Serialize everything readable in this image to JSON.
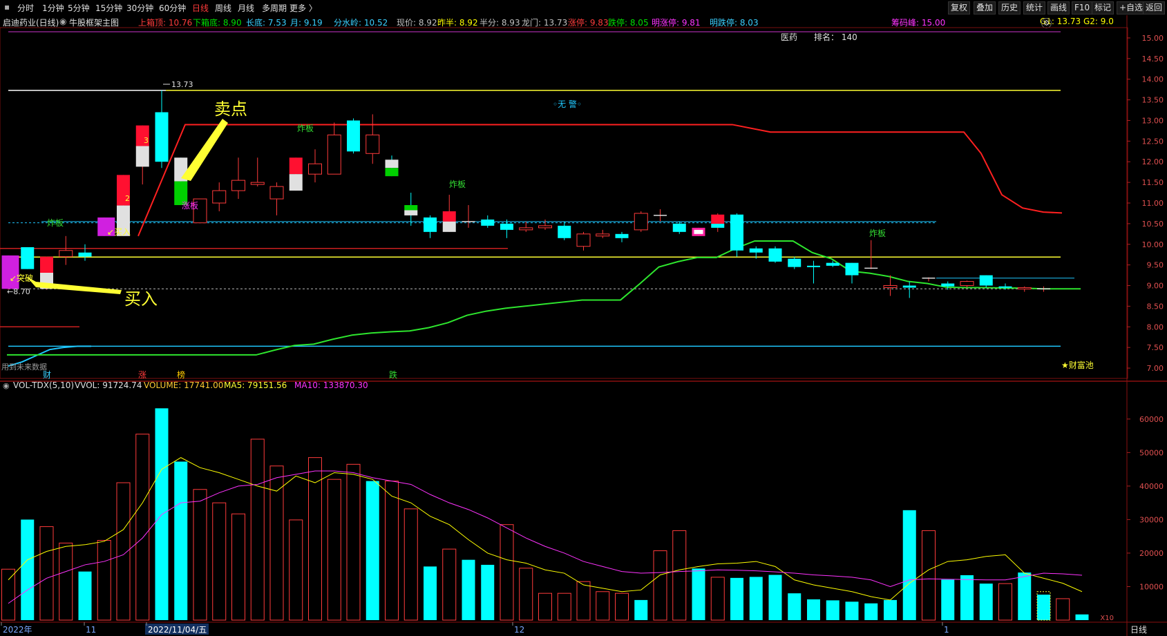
{
  "toolbar": {
    "periods": [
      "分时",
      "1分钟",
      "5分钟",
      "15分钟",
      "30分钟",
      "60分钟",
      "日线",
      "周线",
      "月线",
      "多周期",
      "更多 〉"
    ],
    "active_period": "日线",
    "right_buttons": [
      "复权",
      "叠加",
      "历史",
      "统计",
      "画线",
      "F10",
      "标记",
      "+自选",
      "返回"
    ]
  },
  "info": {
    "stock_name": "启迪药业(日线)",
    "indicator_name": "牛股框架主图",
    "items": [
      {
        "label": "上箱顶: 10.76",
        "color": "#ff3b3b"
      },
      {
        "label": "下箱底: 8.90",
        "color": "#00e000"
      },
      {
        "label": "长底: 7.53",
        "color": "#3ad0ff"
      },
      {
        "label": "月: 9.19",
        "color": "#3ad0ff"
      },
      {
        "label": "分水岭: 10.52",
        "color": "#3ad0ff"
      },
      {
        "label": "现价: 8.92",
        "color": "#c0c0c0"
      },
      {
        "label": "昨半: 8.92",
        "color": "#ffff00"
      },
      {
        "label": "半分: 8.93",
        "color": "#c0c0c0"
      },
      {
        "label": "龙门: 13.73",
        "color": "#c0c0c0"
      },
      {
        "label": "涨停: 9.83",
        "color": "#ff3b3b"
      },
      {
        "label": "跌停: 8.05",
        "color": "#00e000"
      },
      {
        "label": "明涨停: 9.81",
        "color": "#ff33ff"
      },
      {
        "label": "明跌停: 8.03",
        "color": "#3ad0ff"
      },
      {
        "label": "筹码峰: 15.00",
        "color": "#ff33ff"
      },
      {
        "label": "G1: 13.73  G2: 9.0",
        "color": "#ffff00"
      }
    ],
    "sector": "医药",
    "rank": "排名： 140"
  },
  "annotations": {
    "sell_point": "卖点",
    "buy_point": "买入",
    "tupo": "突破",
    "mairu": "买入",
    "zhaban": "炸板",
    "zhangban": "涨板",
    "high_mark": "13.73",
    "low_mark": "8.70",
    "no_alert": "◦无 警◦",
    "future_data": "用到未来数据",
    "cai": "财",
    "zhang": "涨",
    "bang": "榜",
    "die": "跌",
    "fortune_pool": "★财富池",
    "num2": "2",
    "num3": "3"
  },
  "volume_header": {
    "name": "VOL-TDX(5,10)",
    "vvol": "VVOL: 91724.74",
    "volume": "VOLUME: 17741.00",
    "ma5": "MA5: 79151.56",
    "ma10": "MA10: 133870.30"
  },
  "x_axis": {
    "labels": [
      "2022年",
      "11",
      "2022/11/04/五",
      "12",
      "1"
    ],
    "unit": "X10",
    "period": "日线"
  },
  "colors": {
    "up": "#ff3b3b",
    "down": "#00ffff",
    "ma5": "#ffff00",
    "ma10": "#ff33ff",
    "green_line": "#2ee62e",
    "cyan_line": "#1fc8ff"
  },
  "chart_data": {
    "type": "candlestick",
    "price_axis": {
      "ylim": [
        6.75,
        15.25
      ],
      "ticks": [
        7.0,
        7.5,
        8.0,
        8.5,
        9.0,
        9.5,
        10.0,
        10.5,
        11.0,
        11.5,
        12.0,
        12.5,
        13.0,
        13.5,
        14.0,
        14.5,
        15.0
      ]
    },
    "volume_axis": {
      "ylim": [
        0,
        68000
      ],
      "ticks": [
        10000,
        20000,
        30000,
        40000,
        50000,
        60000
      ]
    },
    "candles": [
      {
        "o": 9.73,
        "c": 8.92,
        "h": 9.73,
        "l": 8.9,
        "style": "magenta"
      },
      {
        "o": 9.4,
        "c": 9.93,
        "h": 9.93,
        "l": 9.4,
        "style": "down"
      },
      {
        "o": 9.7,
        "c": 8.92,
        "h": 9.7,
        "l": 8.9,
        "style": "redwhite"
      },
      {
        "o": 9.7,
        "c": 9.85,
        "h": 10.2,
        "l": 9.5,
        "style": "up"
      },
      {
        "o": 9.8,
        "c": 9.7,
        "h": 10.0,
        "l": 9.6,
        "style": "down"
      },
      {
        "o": 10.2,
        "c": 10.65,
        "h": 10.65,
        "l": 10.2,
        "style": "magenta"
      },
      {
        "o": 10.2,
        "c": 11.68,
        "h": 11.68,
        "l": 10.2,
        "style": "redwhite"
      },
      {
        "o": 11.88,
        "c": 12.88,
        "h": 12.88,
        "l": 11.45,
        "style": "redwhite"
      },
      {
        "o": 12.0,
        "c": 13.2,
        "h": 13.73,
        "l": 11.85,
        "style": "down"
      },
      {
        "o": 12.1,
        "c": 10.95,
        "h": 12.1,
        "l": 10.95,
        "style": "whitegreen"
      },
      {
        "o": 11.1,
        "c": 10.52,
        "h": 11.1,
        "l": 10.52,
        "style": "up"
      },
      {
        "o": 11.0,
        "c": 11.3,
        "h": 11.5,
        "l": 10.8,
        "style": "up"
      },
      {
        "o": 11.3,
        "c": 11.55,
        "h": 12.1,
        "l": 11.1,
        "style": "up"
      },
      {
        "o": 11.5,
        "c": 11.45,
        "h": 12.1,
        "l": 11.4,
        "style": "up"
      },
      {
        "o": 11.4,
        "c": 11.1,
        "h": 11.5,
        "l": 10.7,
        "style": "up"
      },
      {
        "o": 11.3,
        "c": 12.1,
        "h": 12.1,
        "l": 11.3,
        "style": "redwhite"
      },
      {
        "o": 11.7,
        "c": 11.95,
        "h": 12.3,
        "l": 11.5,
        "style": "up"
      },
      {
        "o": 11.7,
        "c": 12.65,
        "h": 12.95,
        "l": 11.7,
        "style": "up"
      },
      {
        "o": 12.25,
        "c": 13.0,
        "h": 13.05,
        "l": 12.2,
        "style": "down"
      },
      {
        "o": 12.65,
        "c": 12.2,
        "h": 13.15,
        "l": 11.95,
        "style": "up"
      },
      {
        "o": 11.65,
        "c": 12.05,
        "h": 12.15,
        "l": 11.65,
        "style": "whitegreen"
      },
      {
        "o": 10.7,
        "c": 10.95,
        "h": 11.25,
        "l": 10.45,
        "style": "greenwhite"
      },
      {
        "o": 10.65,
        "c": 10.3,
        "h": 10.7,
        "l": 10.15,
        "style": "down"
      },
      {
        "o": 10.3,
        "c": 10.8,
        "h": 11.2,
        "l": 10.3,
        "style": "redwhite"
      },
      {
        "o": 10.55,
        "c": 10.55,
        "h": 10.95,
        "l": 10.4,
        "style": "doji"
      },
      {
        "o": 10.6,
        "c": 10.45,
        "h": 10.7,
        "l": 10.4,
        "style": "down"
      },
      {
        "o": 10.5,
        "c": 10.35,
        "h": 10.6,
        "l": 10.15,
        "style": "down"
      },
      {
        "o": 10.35,
        "c": 10.4,
        "h": 10.55,
        "l": 10.3,
        "style": "up"
      },
      {
        "o": 10.4,
        "c": 10.45,
        "h": 10.6,
        "l": 10.35,
        "style": "up"
      },
      {
        "o": 10.45,
        "c": 10.15,
        "h": 10.55,
        "l": 10.1,
        "style": "down"
      },
      {
        "o": 9.95,
        "c": 10.25,
        "h": 10.3,
        "l": 9.85,
        "style": "up"
      },
      {
        "o": 10.25,
        "c": 10.2,
        "h": 10.35,
        "l": 10.15,
        "style": "up"
      },
      {
        "o": 10.25,
        "c": 10.15,
        "h": 10.3,
        "l": 10.05,
        "style": "down"
      },
      {
        "o": 10.35,
        "c": 10.75,
        "h": 10.8,
        "l": 10.3,
        "style": "up"
      },
      {
        "o": 10.7,
        "c": 10.7,
        "h": 10.85,
        "l": 10.55,
        "style": "doji"
      },
      {
        "o": 10.5,
        "c": 10.3,
        "h": 10.55,
        "l": 10.25,
        "style": "down"
      },
      {
        "o": 10.25,
        "c": 10.35,
        "h": 10.4,
        "l": 10.2,
        "style": "magentabox"
      },
      {
        "o": 10.4,
        "c": 10.72,
        "h": 10.75,
        "l": 10.3,
        "style": "redcyan"
      },
      {
        "o": 10.72,
        "c": 9.85,
        "h": 10.75,
        "l": 9.7,
        "style": "down"
      },
      {
        "o": 9.9,
        "c": 9.8,
        "h": 9.95,
        "l": 9.65,
        "style": "down"
      },
      {
        "o": 9.9,
        "c": 9.58,
        "h": 9.95,
        "l": 9.55,
        "style": "down"
      },
      {
        "o": 9.65,
        "c": 9.45,
        "h": 9.7,
        "l": 9.4,
        "style": "down"
      },
      {
        "o": 9.48,
        "c": 9.45,
        "h": 9.6,
        "l": 9.05,
        "style": "down"
      },
      {
        "o": 9.55,
        "c": 9.48,
        "h": 9.6,
        "l": 9.45,
        "style": "down"
      },
      {
        "o": 9.55,
        "c": 9.25,
        "h": 9.55,
        "l": 9.05,
        "style": "down"
      },
      {
        "o": 9.42,
        "c": 9.42,
        "h": 10.1,
        "l": 9.4,
        "style": "doji"
      },
      {
        "o": 8.95,
        "c": 9.0,
        "h": 9.25,
        "l": 8.75,
        "style": "up"
      },
      {
        "o": 9.0,
        "c": 8.95,
        "h": 9.1,
        "l": 8.7,
        "style": "down"
      },
      {
        "o": 9.15,
        "c": 9.18,
        "h": 9.2,
        "l": 9.1,
        "style": "doji"
      },
      {
        "o": 9.05,
        "c": 8.98,
        "h": 9.1,
        "l": 8.9,
        "style": "down"
      },
      {
        "o": 9.0,
        "c": 9.1,
        "h": 9.12,
        "l": 8.95,
        "style": "up"
      },
      {
        "o": 9.25,
        "c": 9.0,
        "h": 9.25,
        "l": 8.95,
        "style": "down"
      },
      {
        "o": 8.98,
        "c": 8.95,
        "h": 9.05,
        "l": 8.9,
        "style": "down"
      },
      {
        "o": 8.95,
        "c": 8.92,
        "h": 8.98,
        "l": 8.85,
        "style": "up"
      },
      {
        "o": 8.92,
        "c": 8.92,
        "h": 8.98,
        "l": 8.85,
        "style": "doji"
      }
    ],
    "volume": [
      15200,
      30000,
      27900,
      23000,
      14500,
      23800,
      41000,
      55500,
      63200,
      47300,
      39000,
      35000,
      31700,
      54000,
      46000,
      29900,
      48500,
      42000,
      46500,
      41500,
      41500,
      33200,
      16000,
      21200,
      18000,
      16500,
      28500,
      15500,
      8000,
      8000,
      11500,
      8500,
      8000,
      6000,
      20700,
      26700,
      15400,
      12800,
      12600,
      12900,
      13500,
      8000,
      6200,
      5900,
      5500,
      5000,
      6000,
      32800,
      26700,
      12100,
      13400,
      10900,
      10900,
      14200,
      7600,
      6400,
      1700
    ],
    "volume_up": [
      true,
      false,
      true,
      true,
      false,
      true,
      true,
      true,
      false,
      false,
      true,
      true,
      true,
      true,
      true,
      true,
      true,
      true,
      true,
      false,
      true,
      true,
      false,
      true,
      false,
      false,
      true,
      true,
      true,
      true,
      true,
      true,
      true,
      false,
      true,
      true,
      false,
      true,
      false,
      false,
      false,
      false,
      false,
      false,
      false,
      false,
      false,
      false,
      true,
      false,
      false,
      false,
      true,
      false,
      false,
      true,
      false
    ],
    "ma5": [
      12000,
      18000,
      20500,
      22000,
      22500,
      23500,
      27000,
      35000,
      45000,
      48500,
      45500,
      44000,
      42000,
      40000,
      38500,
      43000,
      41000,
      44000,
      43500,
      42000,
      37000,
      35000,
      31000,
      28500,
      24000,
      20000,
      18000,
      17000,
      15000,
      14000,
      10500,
      9500,
      8500,
      9000,
      13500,
      15000,
      16000,
      16800,
      17000,
      17500,
      16000,
      12000,
      10500,
      9500,
      8500,
      7000,
      6000,
      11000,
      15000,
      17500,
      18000,
      19000,
      19500,
      14000,
      12500,
      11000,
      8500
    ],
    "ma10": [
      5000,
      9000,
      12500,
      14500,
      16500,
      17500,
      19500,
      24500,
      31500,
      35000,
      35500,
      38000,
      40000,
      40500,
      42500,
      43500,
      44500,
      44500,
      44000,
      42500,
      41500,
      40500,
      37500,
      35000,
      33000,
      30500,
      27500,
      24500,
      22000,
      20000,
      17500,
      16000,
      14500,
      14000,
      14200,
      14500,
      14700,
      15000,
      14900,
      14700,
      14400,
      14000,
      13500,
      13200,
      12800,
      12000,
      10000,
      12000,
      12300,
      12200,
      12100,
      12000,
      12000,
      13000,
      14000,
      13800,
      13400
    ],
    "lines": {
      "green": [
        7.32,
        7.32,
        7.32,
        7.32,
        7.32,
        7.32,
        7.32,
        7.32,
        7.32,
        7.32,
        7.32,
        7.32,
        7.32,
        7.32,
        7.44,
        7.55,
        7.58,
        7.7,
        7.8,
        7.85,
        7.88,
        7.9,
        7.98,
        8.1,
        8.28,
        8.38,
        8.45,
        8.5,
        8.55,
        8.6,
        8.65,
        8.65,
        8.65,
        9.04,
        9.45,
        9.58,
        9.68,
        9.68,
        9.9,
        10.08,
        10.08,
        10.08,
        9.8,
        9.65,
        9.35,
        9.3,
        9.22,
        9.1,
        9.05,
        8.96,
        8.95,
        8.95,
        8.94,
        8.94,
        8.92,
        8.92,
        8.92
      ],
      "cyan_low": [
        7.05,
        7.15,
        7.3,
        7.45,
        7.5,
        7.53,
        7.53
      ]
    },
    "levels": {
      "longmen": 13.73,
      "yellow_mid": 9.69,
      "box_top_red": 10.76,
      "cyan_dash": 10.52,
      "white_dash": 8.92,
      "long_bottom": 7.53,
      "red_short": 9.9,
      "red_low_short": 8.0
    }
  }
}
